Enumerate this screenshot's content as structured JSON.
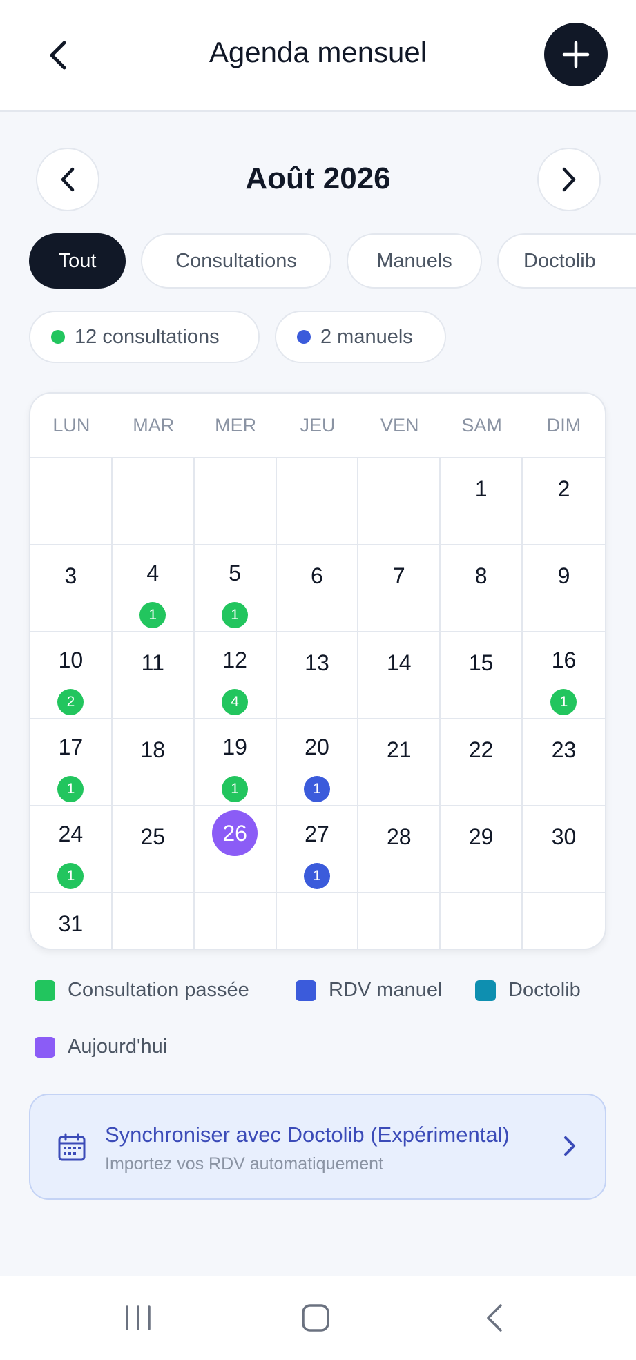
{
  "header": {
    "title": "Agenda mensuel"
  },
  "month": {
    "label": "Août 2026"
  },
  "filters": [
    {
      "label": "Tout",
      "active": true
    },
    {
      "label": "Consultations",
      "active": false
    },
    {
      "label": "Manuels",
      "active": false
    },
    {
      "label": "Doctolib",
      "active": false
    }
  ],
  "stats": [
    {
      "label": "12 consultations",
      "color": "#22c55e"
    },
    {
      "label": "2 manuels",
      "color": "#3b5bdb"
    }
  ],
  "calendar": {
    "weekdays": [
      "LUN",
      "MAR",
      "MER",
      "JEU",
      "VEN",
      "SAM",
      "DIM"
    ],
    "weeks": [
      [
        {
          "day": ""
        },
        {
          "day": ""
        },
        {
          "day": ""
        },
        {
          "day": ""
        },
        {
          "day": ""
        },
        {
          "day": "1"
        },
        {
          "day": "2"
        }
      ],
      [
        {
          "day": "3"
        },
        {
          "day": "4",
          "count": "1",
          "type": "green"
        },
        {
          "day": "5",
          "count": "1",
          "type": "green"
        },
        {
          "day": "6"
        },
        {
          "day": "7"
        },
        {
          "day": "8"
        },
        {
          "day": "9"
        }
      ],
      [
        {
          "day": "10",
          "count": "2",
          "type": "green"
        },
        {
          "day": "11"
        },
        {
          "day": "12",
          "count": "4",
          "type": "green"
        },
        {
          "day": "13"
        },
        {
          "day": "14"
        },
        {
          "day": "15"
        },
        {
          "day": "16",
          "count": "1",
          "type": "green"
        }
      ],
      [
        {
          "day": "17",
          "count": "1",
          "type": "green"
        },
        {
          "day": "18"
        },
        {
          "day": "19",
          "count": "1",
          "type": "green"
        },
        {
          "day": "20",
          "count": "1",
          "type": "blue"
        },
        {
          "day": "21"
        },
        {
          "day": "22"
        },
        {
          "day": "23"
        }
      ],
      [
        {
          "day": "24",
          "count": "1",
          "type": "green"
        },
        {
          "day": "25"
        },
        {
          "day": "26",
          "today": true
        },
        {
          "day": "27",
          "count": "1",
          "type": "blue"
        },
        {
          "day": "28"
        },
        {
          "day": "29"
        },
        {
          "day": "30"
        }
      ],
      [
        {
          "day": "31"
        },
        {
          "day": ""
        },
        {
          "day": ""
        },
        {
          "day": ""
        },
        {
          "day": ""
        },
        {
          "day": ""
        },
        {
          "day": ""
        }
      ]
    ]
  },
  "legend": [
    {
      "label": "Consultation passée",
      "color": "#22c55e"
    },
    {
      "label": "RDV manuel",
      "color": "#3b5bdb"
    },
    {
      "label": "Doctolib",
      "color": "#0e8fb0"
    },
    {
      "label": "Aujourd'hui",
      "color": "#8b5cf6"
    }
  ],
  "sync": {
    "title": "Synchroniser avec Doctolib (Expérimental)",
    "subtitle": "Importez vos RDV automatiquement"
  },
  "icons": {
    "back": "chevron-left-icon",
    "add": "plus-icon",
    "prev_month": "chevron-left-icon",
    "next_month": "chevron-right-icon",
    "sync": "calendar-icon",
    "sync_chevron": "chevron-right-icon"
  }
}
